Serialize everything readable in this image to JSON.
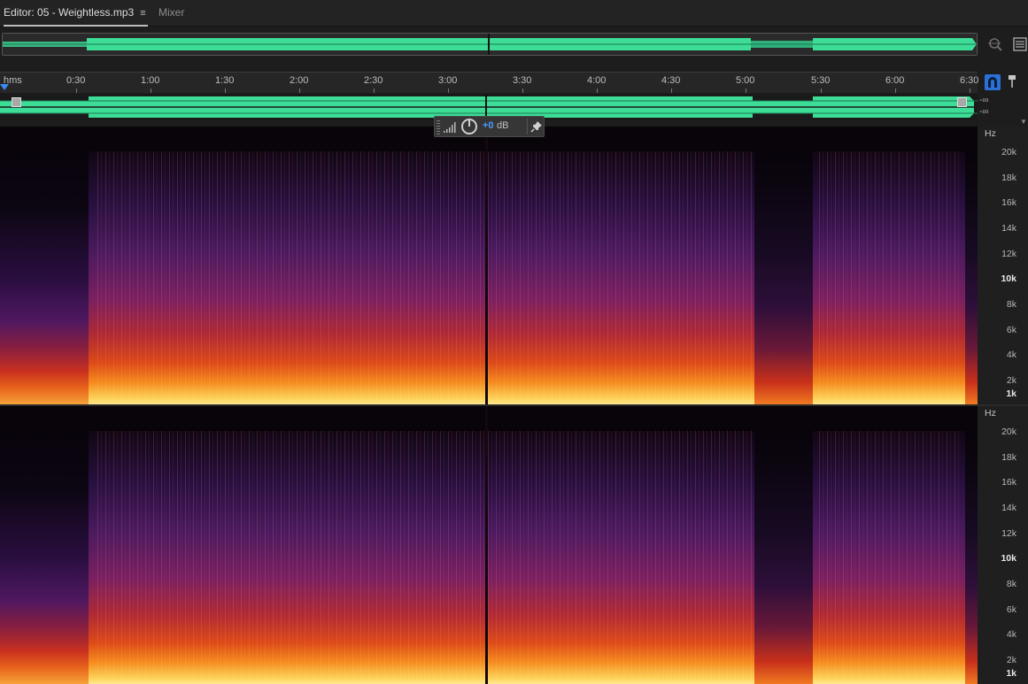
{
  "tabs": {
    "editor_label": "Editor: 05 - Weightless.mp3",
    "editor_menu_glyph": "≡",
    "mixer_label": "Mixer"
  },
  "toolbar": {
    "zoom_icon": "zoom-magnifier-icon",
    "overview_menu_icon": "panel-menu-icon",
    "snap_icon": "snap-magnet-icon",
    "marker_icon": "marker-pin-icon"
  },
  "timeline": {
    "unit_label": "hms",
    "ticks": [
      "0:30",
      "1:00",
      "1:30",
      "2:00",
      "2:30",
      "3:00",
      "3:30",
      "4:00",
      "4:30",
      "5:00",
      "5:30",
      "6:00",
      "6:30"
    ]
  },
  "meters": {
    "top": "-∞",
    "bottom": "-∞"
  },
  "hud": {
    "volume_value": "+0",
    "volume_unit": "dB"
  },
  "frequency_axis": {
    "unit": "Hz",
    "labels": [
      "20k",
      "18k",
      "16k",
      "14k",
      "12k",
      "10k",
      "8k",
      "6k",
      "4k",
      "2k",
      "1k"
    ]
  },
  "colors": {
    "waveform": "#3ddc97",
    "accent": "#3b8bf5",
    "spectral_low": "#ffe890",
    "spectral_mid": "#dc4a18",
    "spectral_high": "#4a1a5e"
  }
}
